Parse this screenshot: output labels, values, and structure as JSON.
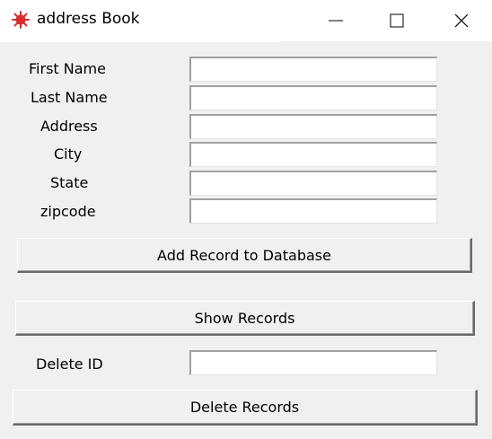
{
  "window": {
    "title": "address Book",
    "icon": "red-feather-icon",
    "controls": {
      "minimize": "minimize-icon",
      "maximize": "maximize-icon",
      "close": "close-icon"
    }
  },
  "form": {
    "first_name_label": "First Name",
    "last_name_label": "Last Name",
    "address_label": "Address",
    "city_label": "City",
    "state_label": "State",
    "zipcode_label": "zipcode",
    "first_name_value": "",
    "last_name_value": "",
    "address_value": "",
    "city_value": "",
    "state_value": "",
    "zipcode_value": ""
  },
  "buttons": {
    "add": "Add Record to Database",
    "show": "Show Records",
    "delete": "Delete Records"
  },
  "delete": {
    "label": "Delete ID",
    "value": ""
  },
  "colors": {
    "icon_red": "#d62d2d",
    "client_bg": "#f0f0f0",
    "titlebar_bg": "#ffffff"
  }
}
